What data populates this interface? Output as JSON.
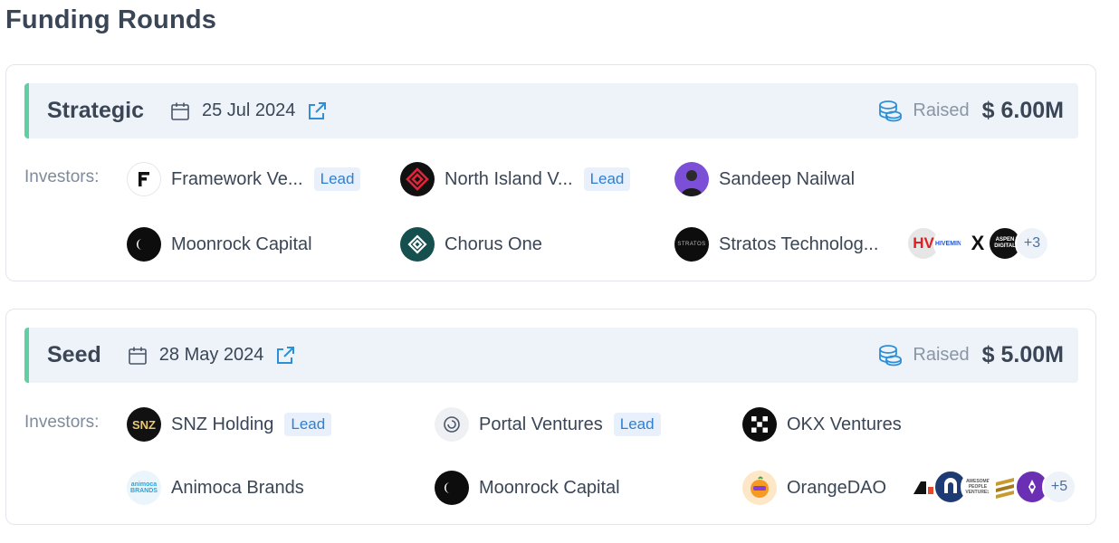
{
  "page": {
    "title": "Funding Rounds"
  },
  "rounds": [
    {
      "name": "Strategic",
      "date": "25 Jul 2024",
      "raised_label": "Raised",
      "raised_amount": "$ 6.00M",
      "investors_label": "Investors:",
      "investors": [
        {
          "name": "Framework Ve...",
          "lead": "Lead",
          "logo": "framework-logo"
        },
        {
          "name": "North Island V...",
          "lead": "Lead",
          "logo": "north-island-logo"
        },
        {
          "name": "Sandeep Nailwal",
          "logo": "sandeep-avatar"
        },
        {
          "name": "Moonrock Capital",
          "logo": "moonrock-logo"
        },
        {
          "name": "Chorus One",
          "logo": "chorus-one-logo"
        },
        {
          "name": "Stratos Technolog...",
          "logo": "stratos-logo",
          "logo_text": "STRATOS"
        }
      ],
      "more_logos": [
        {
          "text": "HV",
          "logo": "hv-logo"
        },
        {
          "text": "HIVEMIND",
          "logo": "hivemind-logo"
        },
        {
          "text": "X",
          "logo": "x-logo"
        },
        {
          "text": "ASPEN DIGITAL",
          "logo": "aspen-digital-logo"
        }
      ],
      "more_count": "+3"
    },
    {
      "name": "Seed",
      "date": "28 May 2024",
      "raised_label": "Raised",
      "raised_amount": "$ 5.00M",
      "investors_label": "Investors:",
      "investors": [
        {
          "name": "SNZ Holding",
          "lead": "Lead",
          "logo": "snz-logo",
          "logo_text": "SNZ"
        },
        {
          "name": "Portal Ventures",
          "lead": "Lead",
          "logo": "portal-logo"
        },
        {
          "name": "OKX Ventures",
          "logo": "okx-logo"
        },
        {
          "name": "Animoca Brands",
          "logo": "animoca-logo",
          "logo_text": "animoca BRANDS"
        },
        {
          "name": "Moonrock Capital",
          "logo": "moonrock-logo"
        },
        {
          "name": "OrangeDAO",
          "logo": "orangedao-logo"
        }
      ],
      "more_logos": [
        {
          "logo": "seed-extra-logo-1"
        },
        {
          "logo": "fancy-logo"
        },
        {
          "text": "AWESOME PEOPLE VENTURES",
          "logo": "awesome-people-logo"
        },
        {
          "logo": "seed-extra-logo-4"
        },
        {
          "logo": "seed-extra-logo-5"
        }
      ],
      "more_count": "+5"
    }
  ],
  "colors": {
    "accent": "#5fd0a3",
    "link": "#2d8fd8",
    "lead_bg": "#e8f1fb",
    "header_bg": "#eef3f9"
  }
}
